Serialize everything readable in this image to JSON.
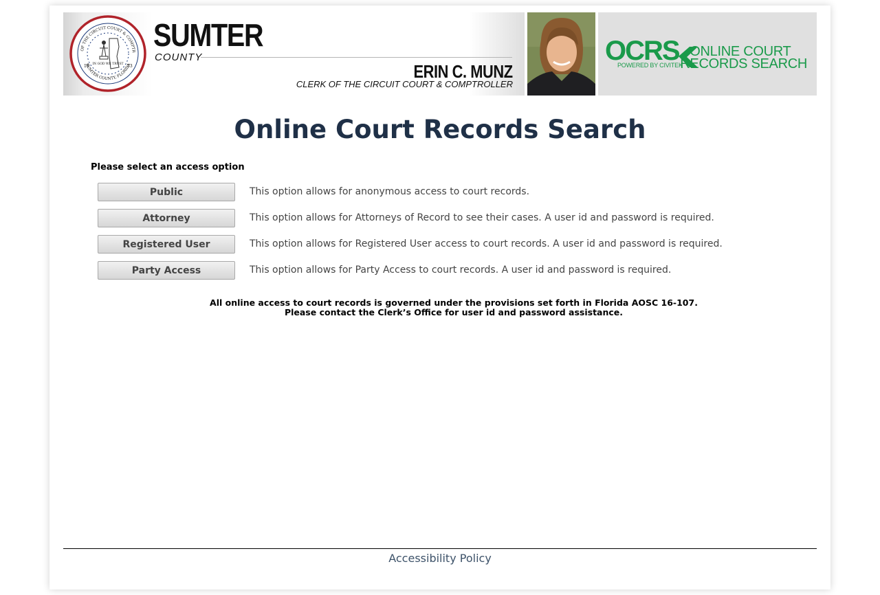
{
  "header": {
    "seal": {
      "top_text": "CLERK OF THE CIRCUIT COURT & COMPTROLLER",
      "bottom_text": "SUMTER COUNTY, FLORIDA",
      "motto": "IN GOD WE TRUST",
      "year_left": "18",
      "year_right": "53"
    },
    "county_name": "SUMTER",
    "county_label": "COUNTY",
    "clerk_name": "ERIN C. MUNZ",
    "clerk_title": "CLERK OF THE CIRCUIT COURT & COMPTROLLER",
    "ocrs_logo": "OCRS",
    "ocrs_powered": "POWERED BY CIVITEK",
    "ocrs_text_line1": "ONLINE COURT",
    "ocrs_text_line2": "RECORDS SEARCH"
  },
  "main": {
    "title": "Online Court Records Search",
    "select_label": "Please select an access option",
    "options": [
      {
        "label": "Public",
        "description": "This option allows for anonymous access to court records."
      },
      {
        "label": "Attorney",
        "description": "This option allows for Attorneys of Record to see their cases. A user id and password is required."
      },
      {
        "label": "Registered User",
        "description": "This option allows for Registered User access to court records. A user id and password is required."
      },
      {
        "label": "Party Access",
        "description": "This option allows for Party Access to court records. A user id and password is required."
      }
    ],
    "notice_line1": "All online access to court records is governed under the provisions set forth in Florida AOSC 16-107.",
    "notice_line2": "Please contact the Clerk’s Office for user id and password assistance."
  },
  "footer": {
    "accessibility_link": "Accessibility Policy"
  },
  "colors": {
    "title": "#1f3047",
    "ocrs_green": "#1a9a4a",
    "seal_red": "#b0232a",
    "seal_blue": "#1c3a7a",
    "footer_link": "#3d5269"
  },
  "icons": {
    "seal": "county-seal-icon",
    "photo": "clerk-photo",
    "ocrs_check": "ocrs-chevron-icon"
  }
}
